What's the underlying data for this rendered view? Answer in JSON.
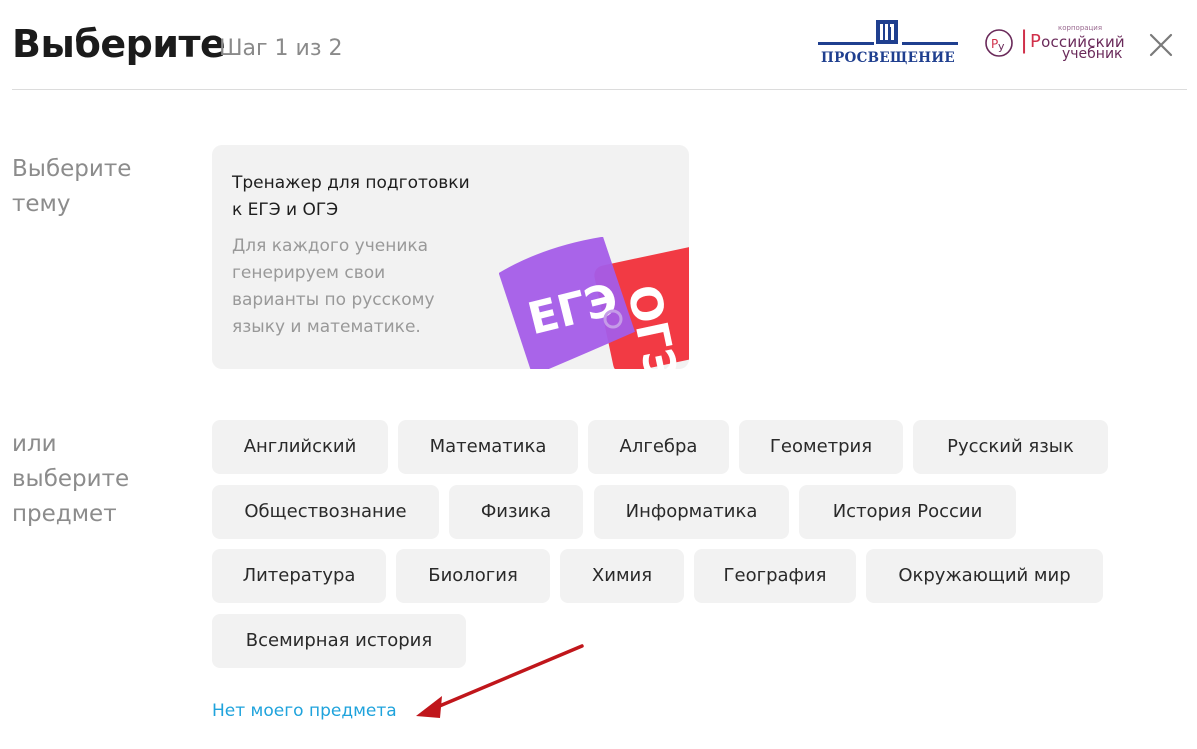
{
  "header": {
    "title": "Выберите",
    "step": "Шаг 1 из 2",
    "logos": {
      "prosveshchenie": "ПРОСВЕЩЕНИЕ",
      "rusuchebnik_small": "корпорация",
      "rusuchebnik_line1": "оссийский",
      "rusuchebnik_line2": "учебник",
      "rusuchebnik_mark": "РУ"
    },
    "close_icon": "close-icon"
  },
  "topic_section": {
    "label_line1": "Выберите",
    "label_line2": "тему",
    "card": {
      "title_line1": "Тренажер для подготовки",
      "title_line2": "к ЕГЭ и ОГЭ",
      "desc_line1": "Для каждого ученика",
      "desc_line2": "генерируем свои",
      "desc_line3": "варианты по русскому",
      "desc_line4": "языку и математике.",
      "art_ege": "ЕГЭ",
      "art_oge": "ОГЭ",
      "colors": {
        "ege": "#a45ce8",
        "oge": "#f23a44"
      }
    }
  },
  "subject_section": {
    "label_line1": "или",
    "label_line2": "выберите",
    "label_line3": "предмет",
    "subjects": [
      "Английский",
      "Математика",
      "Алгебра",
      "Геометрия",
      "Русский язык",
      "Обществознание",
      "Физика",
      "Информатика",
      "История России",
      "Литература",
      "Биология",
      "Химия",
      "География",
      "Окружающий мир",
      "Всемирная история"
    ],
    "no_subject_link": "Нет моего предмета"
  },
  "colors": {
    "link": "#1fa3dc",
    "chip_bg": "#f2f2f2",
    "arrow": "#c0161b",
    "brand_blue": "#1f3f8f"
  }
}
